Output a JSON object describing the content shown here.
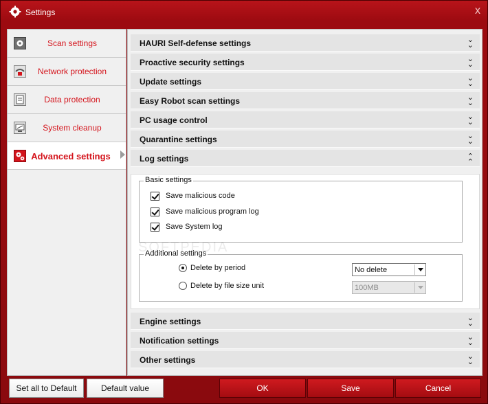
{
  "window": {
    "title": "Settings",
    "icon": "gear-icon",
    "close_glyph": "x"
  },
  "sidebar": {
    "items": [
      {
        "label": "Scan settings",
        "icon": "gear-icon"
      },
      {
        "label": "Network protection",
        "icon": "wifi-icon"
      },
      {
        "label": "Data protection",
        "icon": "document-icon"
      },
      {
        "label": "System cleanup",
        "icon": "monitor-icon"
      },
      {
        "label": "Advanced settings",
        "icon": "gears-icon",
        "active": true
      }
    ]
  },
  "sections": {
    "self_defense": "HAURI Self-defense settings",
    "proactive": "Proactive security settings",
    "update": "Update settings",
    "easy_robot": "Easy Robot scan settings",
    "pc_usage": "PC usage control",
    "quarantine": "Quarantine settings",
    "log": "Log settings",
    "engine": "Engine settings",
    "notification": "Notification settings",
    "other": "Other settings"
  },
  "log_settings": {
    "basic": {
      "title": "Basic settings",
      "options": [
        {
          "label": "Save malicious code",
          "checked": true
        },
        {
          "label": "Save malicious program log",
          "checked": true
        },
        {
          "label": "Save System log",
          "checked": true
        }
      ]
    },
    "additional": {
      "title": "Additional settings",
      "by_period": {
        "label": "Delete by period",
        "selected": true
      },
      "by_size": {
        "label": "Delete by file size unit",
        "selected": false
      },
      "period_select": "No delete",
      "size_select": "100MB"
    }
  },
  "watermark": "SOFTPEDIA",
  "buttons": {
    "set_all_default": "Set all to Default",
    "default_value": "Default value",
    "ok": "OK",
    "save": "Save",
    "cancel": "Cancel"
  },
  "colors": {
    "accent": "#c4121a",
    "sidebar_text": "#d4141c"
  }
}
